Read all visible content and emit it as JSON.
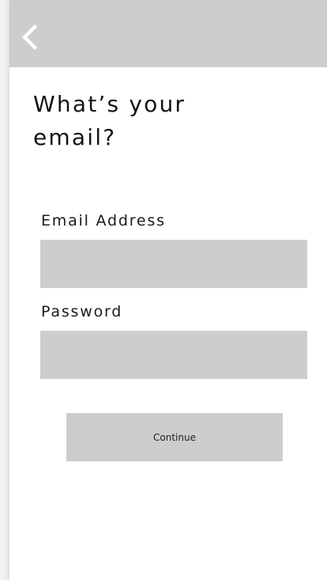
{
  "header": {
    "back_icon": "chevron-left-icon",
    "bar_color": "#cdcdcd"
  },
  "page": {
    "title": "What’s your email?"
  },
  "form": {
    "email": {
      "label": "Email Address",
      "value": "",
      "placeholder": ""
    },
    "password": {
      "label": "Password",
      "value": "",
      "placeholder": ""
    },
    "continue_label": "Continue"
  }
}
